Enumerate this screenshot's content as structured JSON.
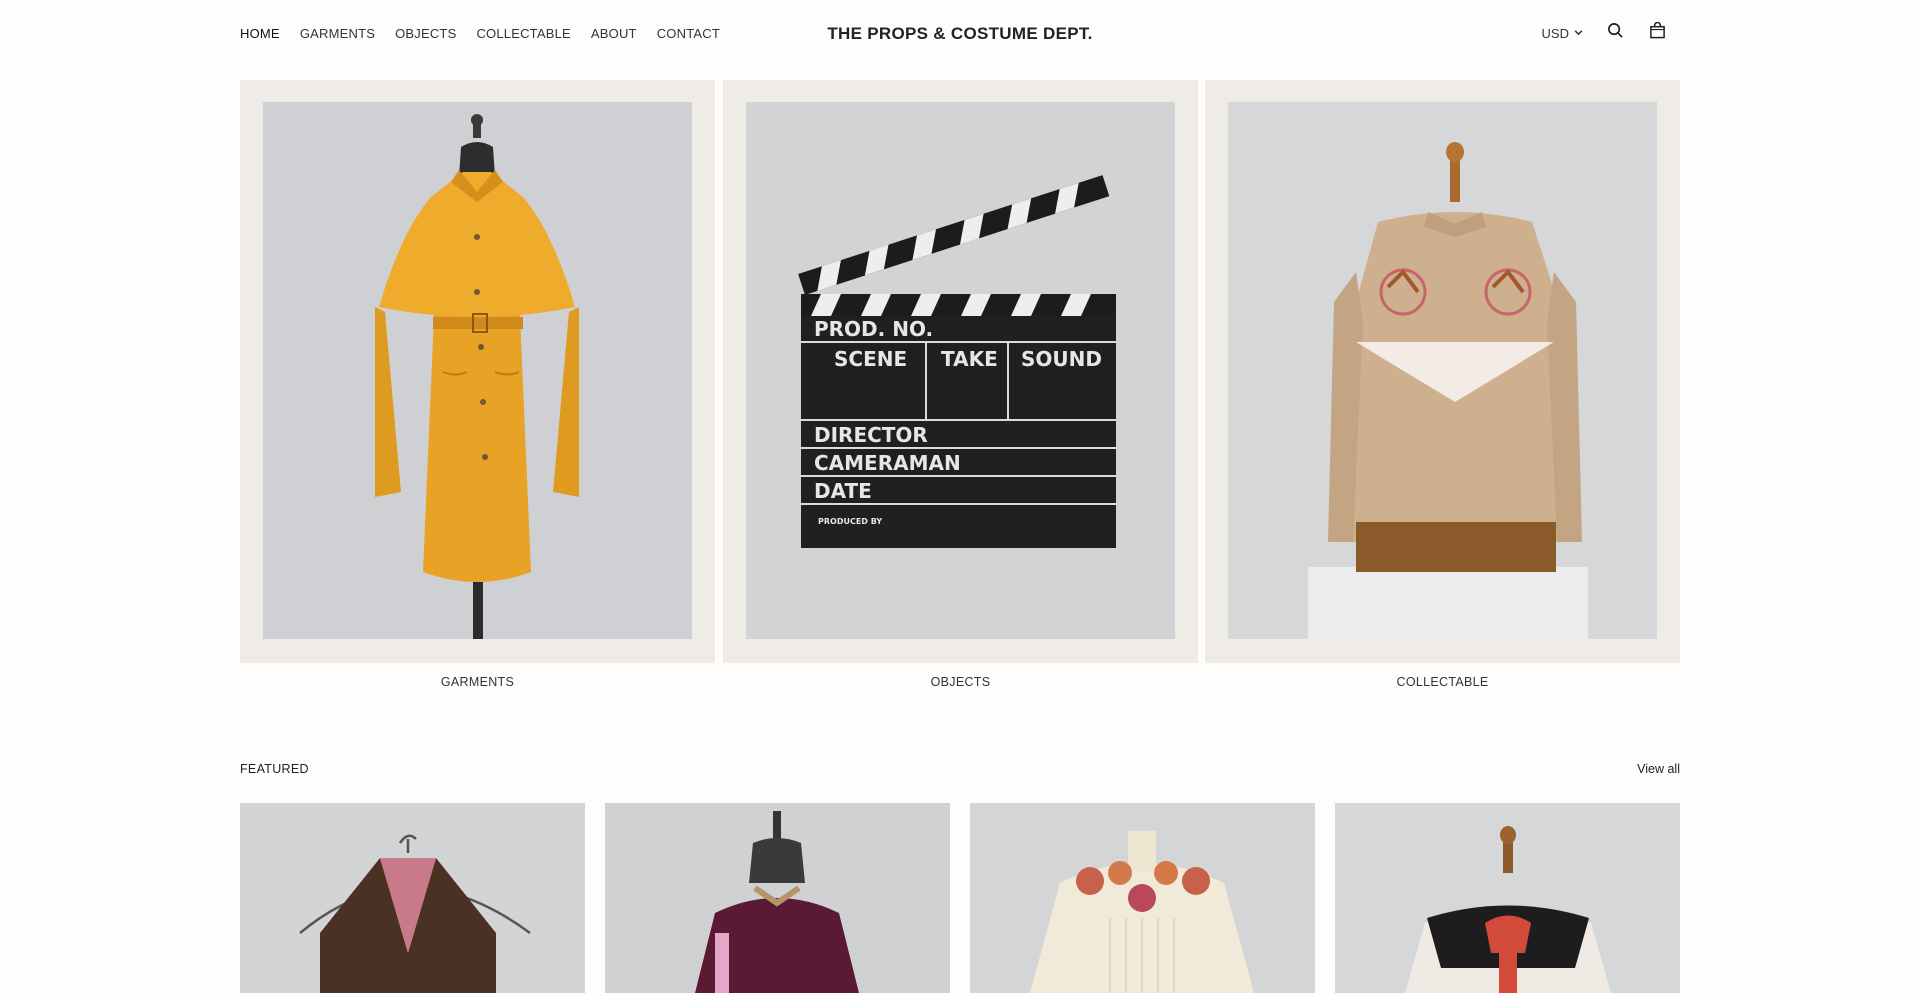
{
  "header": {
    "nav": [
      {
        "label": "HOME",
        "active": true
      },
      {
        "label": "GARMENTS"
      },
      {
        "label": "OBJECTS"
      },
      {
        "label": "COLLECTABLE"
      },
      {
        "label": "ABOUT"
      },
      {
        "label": "CONTACT"
      }
    ],
    "brand": "THE PROPS & COSTUME DEPT.",
    "currency": "USD",
    "icons": [
      "chevron-down-icon",
      "search-icon",
      "bag-icon"
    ]
  },
  "categories": [
    {
      "label": "GARMENTS",
      "image": "yellow-cape-coat"
    },
    {
      "label": "OBJECTS",
      "image": "film-clapperboard"
    },
    {
      "label": "COLLECTABLE",
      "image": "western-embroidered-jacket"
    }
  ],
  "clapperboard": {
    "rows": [
      "PROD. NO.",
      "SCENE",
      "TAKE",
      "SOUND",
      "DIRECTOR",
      "CAMERAMAN",
      "DATE",
      "PRODUCED BY"
    ]
  },
  "featured": {
    "title": "FEATURED",
    "view_all": "View all",
    "items": [
      {
        "image": "corduroy-vest"
      },
      {
        "image": "velvet-jacket"
      },
      {
        "image": "embroidered-blouse"
      },
      {
        "image": "western-shirt"
      }
    ]
  },
  "colors": {
    "background": "#fefdfb",
    "tile_frame": "#efebe6",
    "photo_backdrop": "#cfd1d3",
    "coat_yellow": "#e9a524"
  }
}
